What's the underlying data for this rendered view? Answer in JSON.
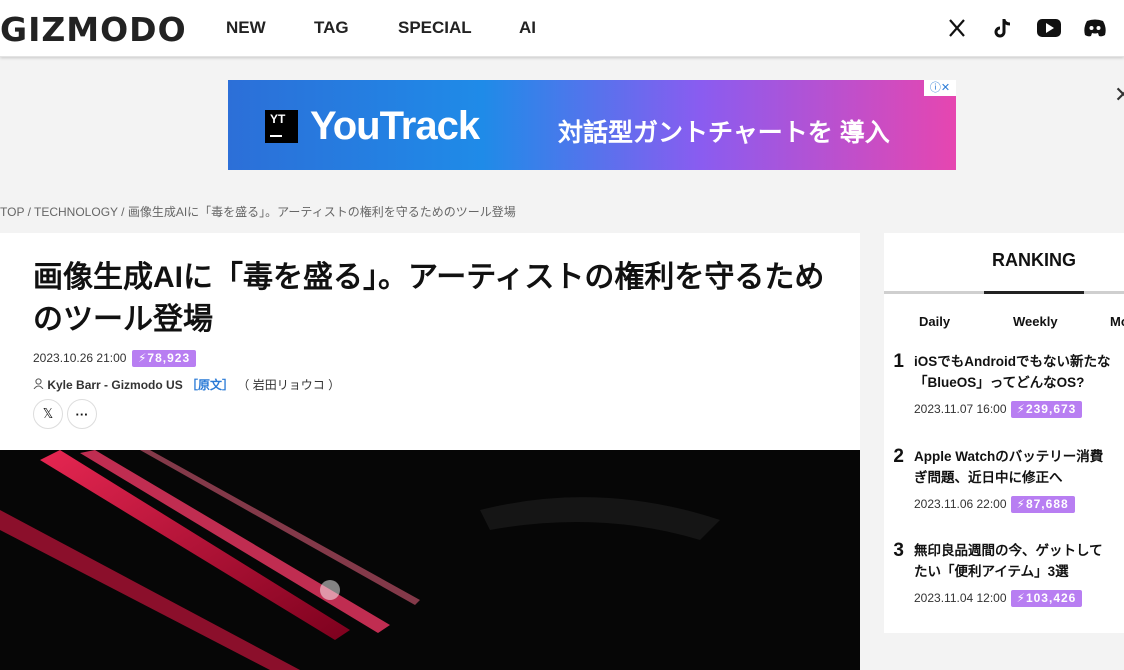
{
  "site": {
    "logo": "GIZMODO"
  },
  "nav": {
    "items": [
      "NEW",
      "TAG",
      "SPECIAL",
      "AI"
    ]
  },
  "social": {
    "icons": [
      "x-icon",
      "tiktok-icon",
      "youtube-icon",
      "discord-icon"
    ]
  },
  "ad": {
    "logo_text": "YT",
    "brand": "YouTrack",
    "copy": "対話型ガントチャートを 導入",
    "info": "ⓘ✕",
    "close": "✕"
  },
  "breadcrumb": "TOP / TECHNOLOGY / 画像生成AIに「毒を盛る」。アーティストの権利を守るためのツール登場",
  "article": {
    "title": "画像生成AIに「毒を盛る」。アーティストの権利を守るためのツール登場",
    "date": "2023.10.26 21:00",
    "views": "⚡78,923",
    "author": "Kyle Barr - Gizmodo US",
    "source_label": "［原文］",
    "translator": "（ 岩田リョウコ ）",
    "share_x": "𝕏",
    "share_more": "···"
  },
  "ranking": {
    "heading": "RANKING",
    "tabs": [
      "Daily",
      "Weekly",
      "Mo"
    ],
    "items": [
      {
        "rank": "1",
        "title_line1": "iOSでもAndroidでもない新たな",
        "title_line2": "「BlueOS」ってどんなOS?",
        "date": "2023.11.07 16:00",
        "views": "⚡239,673"
      },
      {
        "rank": "2",
        "title_line1": "Apple Watchのバッテリー消費",
        "title_line2": "ぎ問題、近日中に修正へ",
        "date": "2023.11.06 22:00",
        "views": "⚡87,688"
      },
      {
        "rank": "3",
        "title_line1": "無印良品週間の今、ゲットして",
        "title_line2": "たい「便利アイテム」3選",
        "date": "2023.11.04 12:00",
        "views": "⚡103,426"
      }
    ]
  },
  "colors": {
    "accent_purple": "#b87ef2",
    "link_blue": "#2a7ad6"
  }
}
